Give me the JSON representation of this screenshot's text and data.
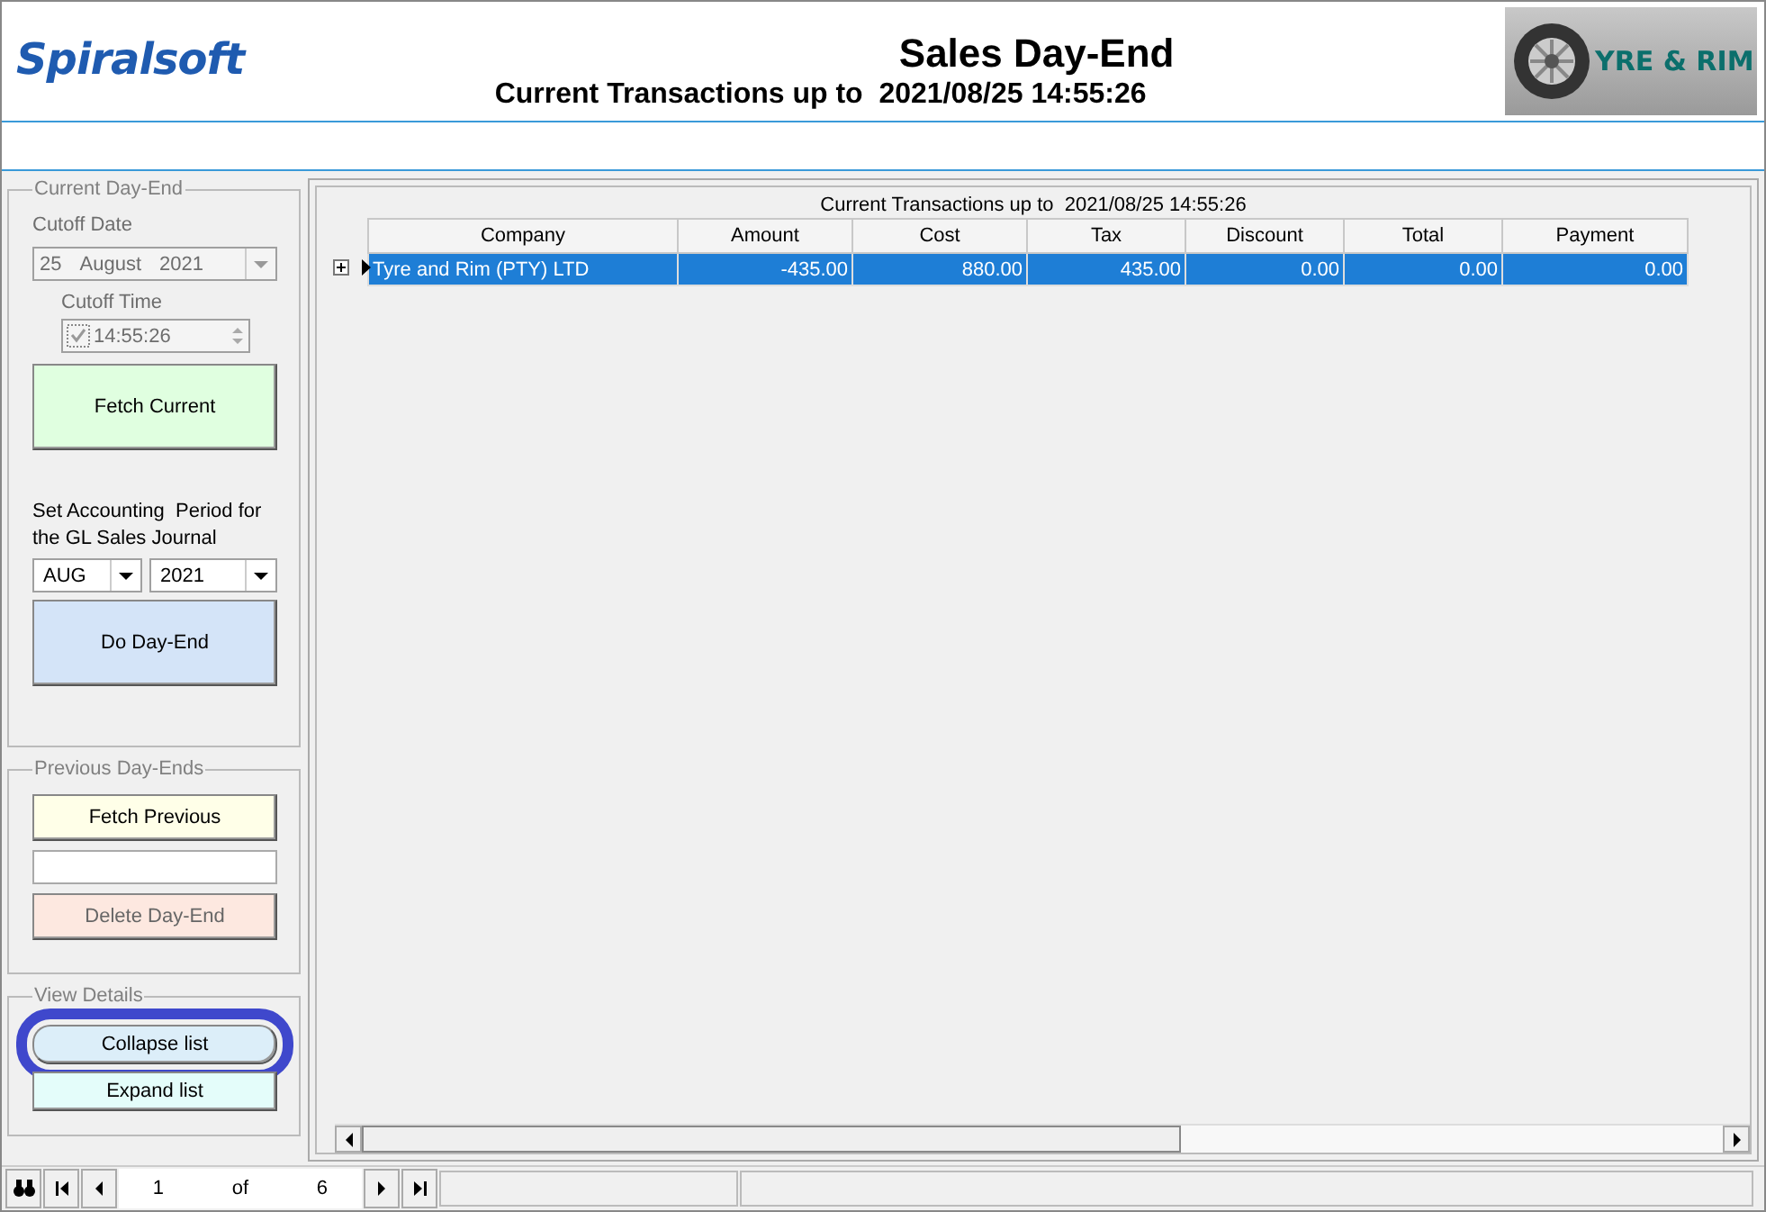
{
  "header": {
    "brand": "Spiralsoft",
    "title": "Sales Day-End",
    "subtitle": "Current Transactions up to  2021/08/25 14:55:26",
    "logo_text": "YRE & RIM"
  },
  "current_day_end": {
    "legend": "Current Day-End",
    "cutoff_date_label": "Cutoff Date",
    "cutoff_date": {
      "day": "25",
      "month": "August",
      "year": "2021",
      "disabled": true
    },
    "cutoff_time_label": "Cutoff Time",
    "cutoff_time": {
      "value": "14:55:26",
      "checked": true,
      "disabled": true
    },
    "fetch_button": "Fetch Current",
    "period_label": "Set Accounting  Period for the GL Sales Journal",
    "period_month": "AUG",
    "period_year": "2021",
    "day_end_button": "Do Day-End"
  },
  "previous_day_ends": {
    "legend": "Previous Day-Ends",
    "fetch_button": "Fetch Previous",
    "delete_button": {
      "label": "Delete Day-End",
      "disabled": true
    }
  },
  "view_details": {
    "legend": "View Details",
    "buttons": [
      {
        "label": "Collapse list",
        "highlighted": true
      },
      {
        "label": "Expand list",
        "highlighted": false
      }
    ]
  },
  "grid": {
    "caption": "Current Transactions up to  2021/08/25 14:55:26",
    "columns": [
      "Company",
      "Amount",
      "Cost",
      "Tax",
      "Discount",
      "Total",
      "Payment"
    ],
    "rows": [
      {
        "selected": true,
        "cells": [
          "Tyre and Rim (PTY) LTD",
          "-435.00",
          "880.00",
          "435.00",
          "0.00",
          "0.00",
          "0.00"
        ]
      }
    ]
  },
  "navigator": {
    "current": "1",
    "of": "of",
    "total": "6"
  }
}
